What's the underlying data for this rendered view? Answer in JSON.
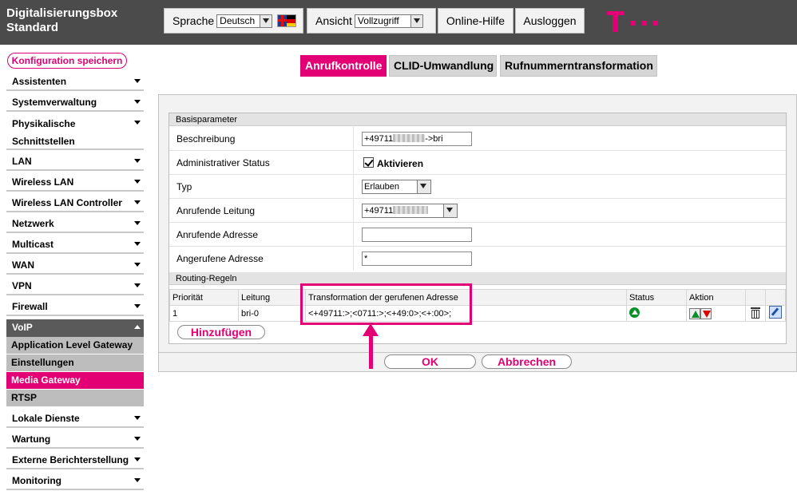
{
  "header": {
    "title_line1": "Digitalisierungsbox",
    "title_line2": "Standard",
    "language_label": "Sprache",
    "language_value": "Deutsch",
    "view_label": "Ansicht",
    "view_value": "Vollzugriff",
    "help_label": "Online-Hilfe",
    "logout_label": "Ausloggen"
  },
  "sidebar": {
    "save_label": "Konfiguration speichern",
    "items": [
      {
        "label": "Assistenten"
      },
      {
        "label": "Systemverwaltung"
      },
      {
        "label": "Physikalische"
      },
      {
        "label": "Schnittstellen"
      },
      {
        "label": "LAN"
      },
      {
        "label": "Wireless LAN"
      },
      {
        "label": "Wireless LAN Controller"
      },
      {
        "label": "Netzwerk"
      },
      {
        "label": "Multicast"
      },
      {
        "label": "WAN"
      },
      {
        "label": "VPN"
      },
      {
        "label": "Firewall"
      },
      {
        "label": "VoIP"
      },
      {
        "label": "Lokale Dienste"
      },
      {
        "label": "Wartung"
      },
      {
        "label": "Externe Berichterstellung"
      },
      {
        "label": "Monitoring"
      }
    ],
    "voip_sub": [
      {
        "label": "Application Level Gateway"
      },
      {
        "label": "Einstellungen"
      },
      {
        "label": "Media Gateway"
      },
      {
        "label": "RTSP"
      }
    ]
  },
  "tabs": [
    {
      "label": "Anrufkontrolle"
    },
    {
      "label": "CLID-Umwandlung"
    },
    {
      "label": "Rufnummerntransformation"
    }
  ],
  "form": {
    "section_basic": "Basisparameter",
    "fields": {
      "beschreibung": {
        "label": "Beschreibung",
        "prefix": "+49711",
        "suffix": "->bri"
      },
      "admin_status": {
        "label": "Administrativer Status",
        "checkbox_label": "Aktivieren"
      },
      "typ": {
        "label": "Typ",
        "value": "Erlauben"
      },
      "anrufende_leitung": {
        "label": "Anrufende Leitung",
        "value": "+49711"
      },
      "anrufende_adresse": {
        "label": "Anrufende Adresse",
        "value": ""
      },
      "angerufene_adresse": {
        "label": "Angerufene Adresse",
        "value": "*"
      }
    },
    "section_routing": "Routing-Regeln",
    "routing_table": {
      "columns": [
        "Priorität",
        "Leitung",
        "Transformation der gerufenen Adresse",
        "Status",
        "Aktion"
      ],
      "rows": [
        {
          "prioritaet": "1",
          "leitung": "bri-0",
          "transformation": "<+49711:>;<0711:>;<+49:0>;<+:00>;"
        }
      ]
    },
    "add_label": "Hinzufügen"
  },
  "buttons": {
    "ok_label": "OK",
    "cancel_label": "Abbrechen"
  },
  "colors": {
    "accent": "#e20074",
    "header_bg": "#4b4b4b",
    "status_ok": "#0a8f2a"
  }
}
